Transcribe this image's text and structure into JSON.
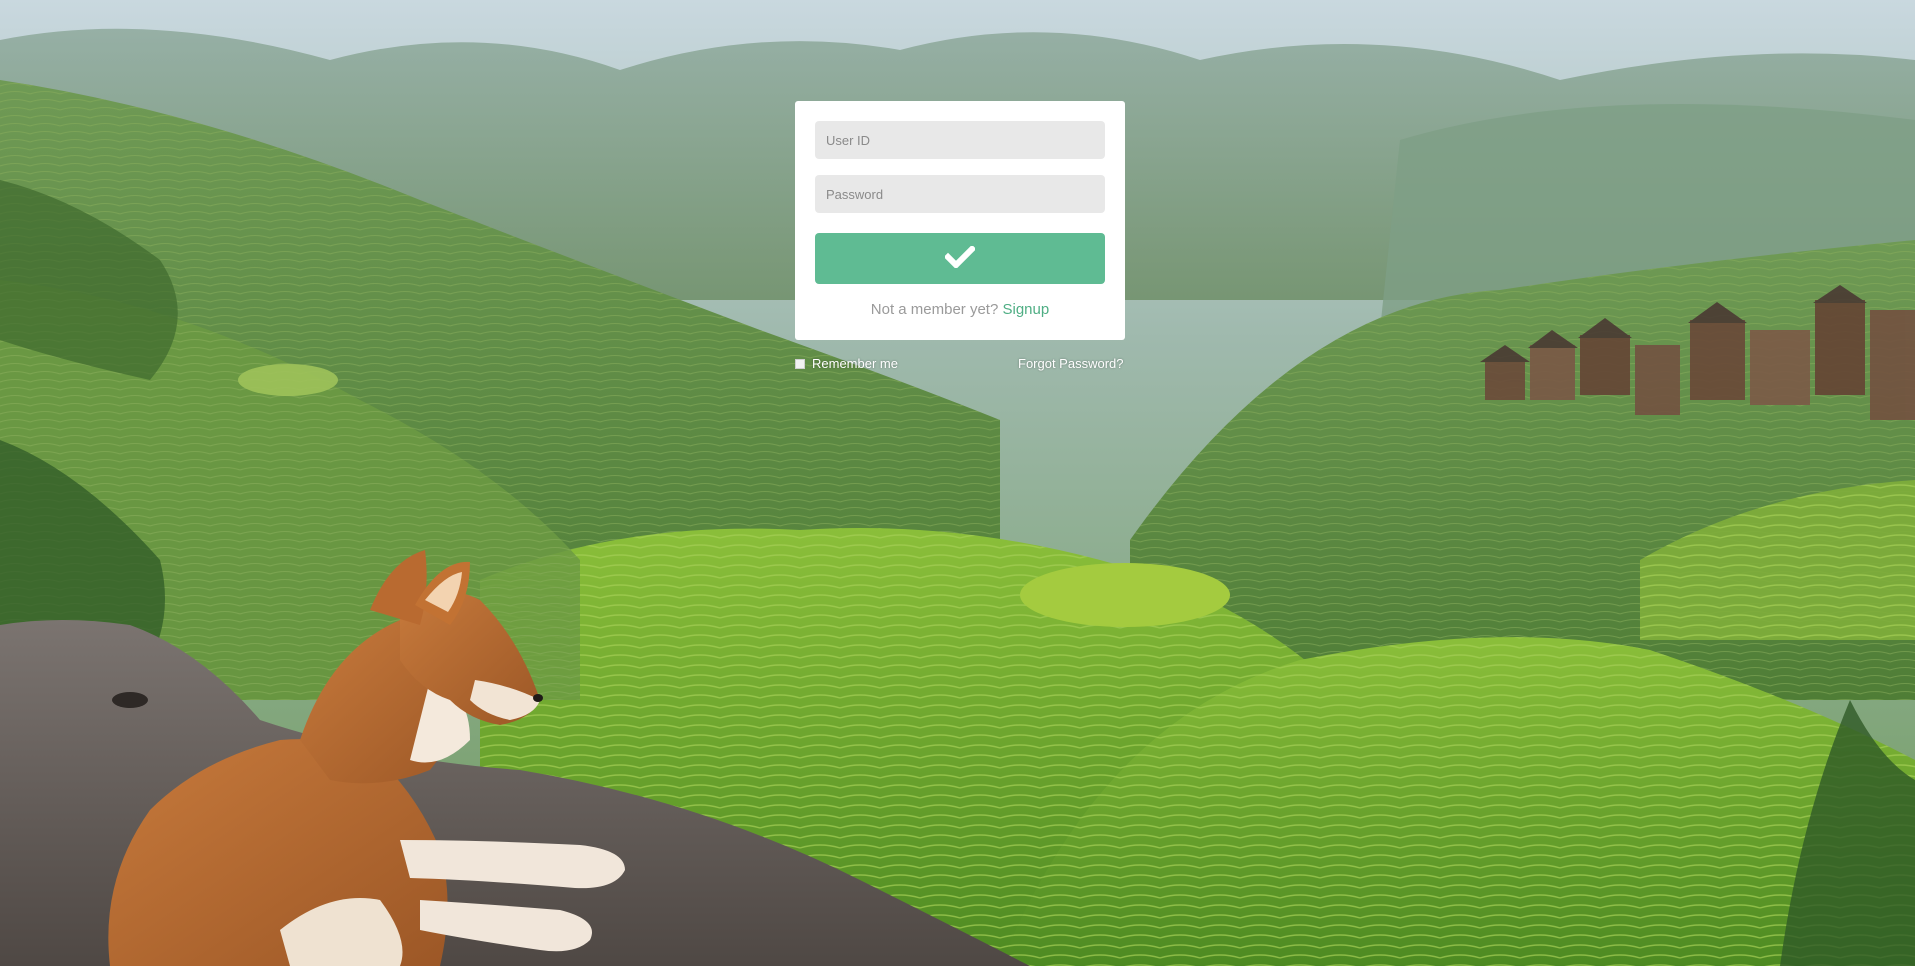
{
  "login": {
    "user_id_placeholder": "User ID",
    "password_placeholder": "Password",
    "submit_icon": "checkmark-icon",
    "signup_prompt": "Not a member yet?",
    "signup_link": "Signup",
    "remember_label": "Remember me",
    "forgot_label": "Forgot Password?"
  },
  "colors": {
    "accent": "#5fbb93",
    "link": "#4fae84",
    "card_bg": "#ffffff",
    "field_bg": "#e8e8e8"
  }
}
